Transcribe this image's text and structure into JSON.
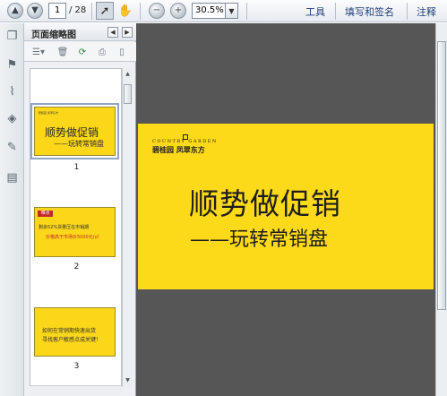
{
  "toolbar": {
    "prev_icon": "arrow-up-icon",
    "next_icon": "arrow-down-icon",
    "current_page": "1",
    "page_total": "/ 28",
    "zoom_value": "30.5%",
    "menu": {
      "tools": "工具",
      "fill_sign": "填写和签名",
      "comment": "注释"
    }
  },
  "sidebar": {
    "panel_title": "页面缩略图"
  },
  "thumbnails": [
    {
      "number": "1",
      "title": "顺势做促销",
      "subtitle": "——玩转常销盘"
    },
    {
      "number": "2",
      "badge": "难点",
      "line1": "剩余52%货量压在市销期",
      "line2": "价格高于市场价5000元/㎡"
    },
    {
      "number": "3",
      "line1": "如何在常销期快速出货",
      "line2": "寻找客户敏感点成关键！"
    }
  ],
  "page": {
    "logo_en": "COUNTRY  GARDEN",
    "logo_cn": "碧桂园 凤翠东方",
    "title": "顺势做促销",
    "subtitle": "——玩转常销盘"
  },
  "colors": {
    "slide_yellow": "#fcd919",
    "badge_red": "#c0282d",
    "doc_background": "#565656"
  }
}
